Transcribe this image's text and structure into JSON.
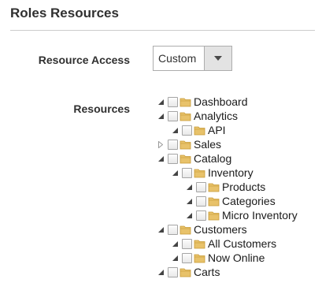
{
  "section": {
    "title": "Roles Resources"
  },
  "form": {
    "resource_access_label": "Resource Access",
    "resource_access_value": "Custom",
    "resources_label": "Resources"
  },
  "tree": {
    "dashboard": "Dashboard",
    "analytics": "Analytics",
    "api": "API",
    "sales": "Sales",
    "catalog": "Catalog",
    "inventory": "Inventory",
    "products": "Products",
    "categories": "Categories",
    "micro_inventory": "Micro Inventory",
    "customers": "Customers",
    "all_customers": "All Customers",
    "now_online": "Now Online",
    "carts": "Carts"
  },
  "colors": {
    "folder": "#e8c26a",
    "folder_dark": "#c79a36",
    "checkbox_border": "#a5a5a5",
    "divider": "#cccccc"
  }
}
